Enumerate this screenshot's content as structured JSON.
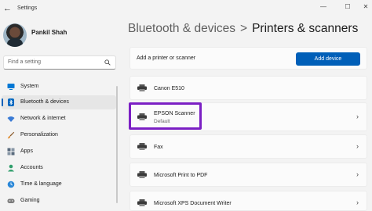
{
  "window": {
    "title": "Settings",
    "back_glyph": "←",
    "minimize_glyph": "—",
    "maximize_glyph": "☐",
    "close_glyph": "✕"
  },
  "profile": {
    "name": "Pankil Shah"
  },
  "search": {
    "placeholder": "Find a setting"
  },
  "sidebar": {
    "items": [
      {
        "label": "System",
        "icon": "monitor-icon",
        "color": "#0078d4",
        "active": false
      },
      {
        "label": "Bluetooth & devices",
        "icon": "bluetooth-icon",
        "color": "#0067c0",
        "active": true
      },
      {
        "label": "Network & internet",
        "icon": "wifi-icon",
        "color": "#3a7bd5",
        "active": false
      },
      {
        "label": "Personalization",
        "icon": "brush-icon",
        "color": "#e08a2c",
        "active": false
      },
      {
        "label": "Apps",
        "icon": "apps-icon",
        "color": "#5a6b7d",
        "active": false
      },
      {
        "label": "Accounts",
        "icon": "person-icon",
        "color": "#2f9e6b",
        "active": false
      },
      {
        "label": "Time & language",
        "icon": "globe-clock-icon",
        "color": "#2b88d8",
        "active": false
      },
      {
        "label": "Gaming",
        "icon": "gamepad-icon",
        "color": "#7a7a7a",
        "active": false
      }
    ]
  },
  "breadcrumb": {
    "parent": "Bluetooth & devices",
    "separator": ">",
    "current": "Printers & scanners"
  },
  "add_printer": {
    "label": "Add a printer or scanner",
    "button": "Add device"
  },
  "devices": [
    {
      "name": "Canon E510",
      "subtitle": ""
    },
    {
      "name": "EPSON Scanner",
      "subtitle": "Default"
    },
    {
      "name": "Fax",
      "subtitle": ""
    },
    {
      "name": "Microsoft Print to PDF",
      "subtitle": ""
    },
    {
      "name": "Microsoft XPS Document Writer",
      "subtitle": ""
    }
  ],
  "chevron_glyph": "›",
  "colors": {
    "accent": "#005fb8",
    "highlight_box": "#7b1fc4"
  }
}
